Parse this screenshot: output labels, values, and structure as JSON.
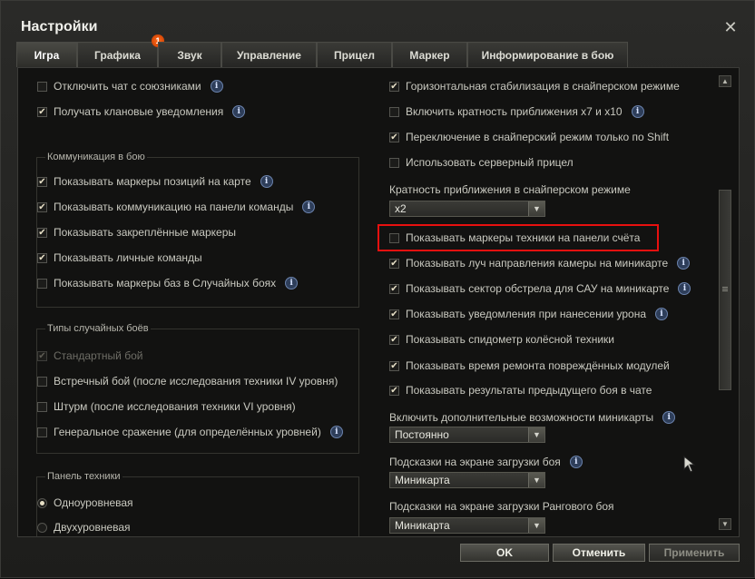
{
  "window": {
    "title": "Настройки"
  },
  "tabs": [
    {
      "label": "Игра",
      "active": true
    },
    {
      "label": "Графика",
      "badge": "1"
    },
    {
      "label": "Звук"
    },
    {
      "label": "Управление"
    },
    {
      "label": "Прицел"
    },
    {
      "label": "Маркер"
    },
    {
      "label": "Информирование в бою"
    }
  ],
  "left": {
    "top_items": [
      {
        "label": "Отключить чат с союзниками",
        "checked": false,
        "info": true
      },
      {
        "label": "Получать клановые уведомления",
        "checked": true,
        "info": true
      }
    ],
    "communication": {
      "title": "Коммуникация в бою",
      "items": [
        {
          "label": "Показывать маркеры позиций на карте",
          "checked": true,
          "info": true
        },
        {
          "label": "Показывать коммуникацию на панели команды",
          "checked": true,
          "info": true
        },
        {
          "label": "Показывать закреплённые маркеры",
          "checked": true,
          "info": false
        },
        {
          "label": "Показывать личные команды",
          "checked": true,
          "info": false
        },
        {
          "label": "Показывать маркеры баз в Случайных боях",
          "checked": false,
          "info": true
        }
      ]
    },
    "battle_types": {
      "title": "Типы случайных боёв",
      "items": [
        {
          "label": "Стандартный бой",
          "checked": true,
          "disabled": true
        },
        {
          "label": "Встречный бой (после исследования техники IV уровня)",
          "checked": false
        },
        {
          "label": "Штурм (после исследования техники VI уровня)",
          "checked": false
        },
        {
          "label": "Генеральное сражение (для определённых уровней)",
          "checked": false,
          "info": true
        }
      ]
    },
    "vehicle_panel": {
      "title": "Панель техники",
      "options": [
        {
          "label": "Одноуровневая",
          "selected": true
        },
        {
          "label": "Двухуровневая",
          "selected": false
        }
      ]
    }
  },
  "right": {
    "items_top": [
      {
        "label": "Горизонтальная стабилизация в снайперском режиме",
        "checked": true,
        "info": false
      },
      {
        "label": "Включить кратность приближения x7 и x10",
        "checked": false,
        "info": true
      },
      {
        "label": "Переключение в снайперский режим только по Shift",
        "checked": true,
        "info": false
      },
      {
        "label": "Использовать серверный прицел",
        "checked": false,
        "info": false
      }
    ],
    "zoom": {
      "label": "Кратность приближения в снайперском режиме",
      "value": "x2"
    },
    "items_bottom": [
      {
        "label": "Показывать маркеры техники на панели счёта",
        "checked": false,
        "info": false
      },
      {
        "label": "Показывать луч направления камеры на миникарте",
        "checked": true,
        "info": true
      },
      {
        "label": "Показывать сектор обстрела для САУ на миникарте",
        "checked": true,
        "info": true
      },
      {
        "label": "Показывать уведомления при нанесении урона",
        "checked": true,
        "info": true
      },
      {
        "label": "Показывать спидометр колёсной техники",
        "checked": true,
        "info": false
      },
      {
        "label": "Показывать время ремонта повреждённых модулей",
        "checked": true,
        "info": false
      },
      {
        "label": "Показывать результаты предыдущего боя в чате",
        "checked": true,
        "info": false
      }
    ],
    "minimap": {
      "label": "Включить дополнительные возможности миникарты",
      "value": "Постоянно"
    },
    "loading_hints": {
      "label": "Подсказки на экране загрузки боя",
      "value": "Миникарта"
    },
    "ranked_hints": {
      "label": "Подсказки на экране загрузки Рангового боя",
      "value": "Миникарта"
    }
  },
  "footer": {
    "ok": "OK",
    "cancel": "Отменить",
    "apply": "Применить"
  },
  "icons": {
    "info": "i",
    "check": "✔",
    "close": "✕"
  },
  "colors": {
    "highlight": "#e8100f",
    "badge": "#e05010"
  }
}
